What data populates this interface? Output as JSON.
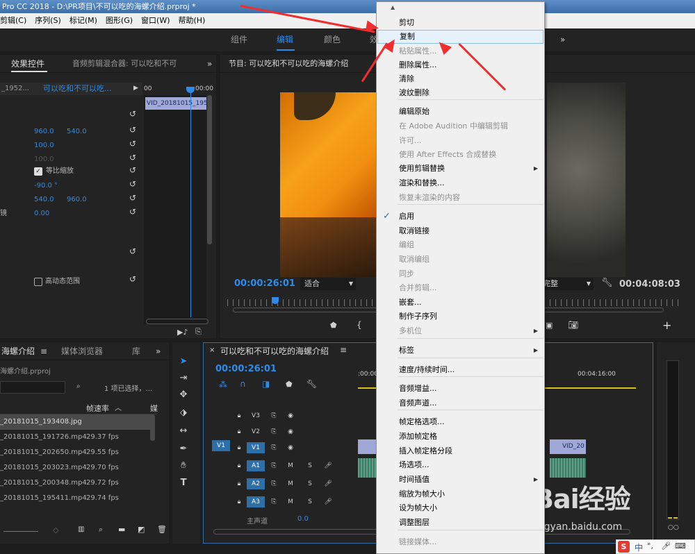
{
  "titlebar": {
    "text": "Pro CC 2018 - D:\\PR项目\\不可以吃的海螺介绍.prproj *"
  },
  "menubar": [
    "剪辑(C)",
    "序列(S)",
    "标记(M)",
    "图形(G)",
    "窗口(W)",
    "帮助(H)"
  ],
  "workspaces": [
    "组件",
    "编辑",
    "颜色",
    "效"
  ],
  "effect_controls": {
    "tab_label": "效果控件",
    "tab_mixer": "音频剪辑混合器: 可以吃和不可",
    "source_clip": "_1952...",
    "sequence": "可以吃和不可以吃...",
    "ruler_start": "00",
    "ruler_end": "00:00",
    "clip_label": "VID_20181015_195",
    "rows": {
      "pos_x": "960.0",
      "pos_y": "540.0",
      "scale": "100.0",
      "scale_w": "100.0",
      "uniform": "等比缩放",
      "rotation": "-90.0 °",
      "anchor_x": "540.0",
      "anchor_y": "960.0",
      "flicker_label": "镜",
      "flicker": "0.00",
      "hdr": "高动态范围"
    }
  },
  "program_monitor": {
    "title": "节目: 可以吃和不可以吃的海螺介绍",
    "timecode": "00:00:26:01",
    "fit": "适合",
    "quality": "完整",
    "duration": "00:04:08:03"
  },
  "project": {
    "tab": "海螺介绍",
    "tab2": "媒体浏览器",
    "tab3": "库",
    "file": "海螺介绍.prproj",
    "selected": "1 项已选择，...",
    "col_framerate": "帧速率",
    "col_more": "媒",
    "items": [
      {
        "name": "_20181015_193408.jpg",
        "fps": ""
      },
      {
        "name": "_20181015_191726.mp4",
        "fps": "29.37 fps"
      },
      {
        "name": "_20181015_202650.mp4",
        "fps": "29.55 fps"
      },
      {
        "name": "_20181015_203023.mp4",
        "fps": "29.70 fps"
      },
      {
        "name": "_20181015_200348.mp4",
        "fps": "29.72 fps"
      },
      {
        "name": "_20181015_195411.mp4",
        "fps": "29.74 fps"
      }
    ]
  },
  "timeline": {
    "title": "可以吃和不可以吃的海螺介绍",
    "timecode": "00:00:26:01",
    "ruler_left": ":00:00",
    "ruler_mid": "00:04:16:00",
    "ruler_right": "0",
    "tracks": [
      "V3",
      "V2",
      "V1",
      "A1",
      "A2",
      "A3"
    ],
    "src": "V1",
    "master": "主声道",
    "master_val": "0.0",
    "clip_v": "VID_20",
    "clip_a": "fx"
  },
  "context_menu": {
    "items": [
      {
        "label": "剪切",
        "state": "normal"
      },
      {
        "label": "复制",
        "state": "highlight"
      },
      {
        "label": "粘贴属性...",
        "state": "disabled"
      },
      {
        "label": "删除属性...",
        "state": "normal"
      },
      {
        "label": "清除",
        "state": "normal"
      },
      {
        "label": "波纹删除",
        "state": "normal"
      },
      {
        "label": "编辑原始",
        "state": "normal"
      },
      {
        "label": "在 Adobe Audition 中编辑剪辑",
        "state": "disabled"
      },
      {
        "label": "许可...",
        "state": "disabled"
      },
      {
        "label": "使用 After Effects 合成替换",
        "state": "disabled"
      },
      {
        "label": "使用剪辑替换",
        "state": "normal"
      },
      {
        "label": "渲染和替换...",
        "state": "normal"
      },
      {
        "label": "恢复未渲染的内容",
        "state": "disabled"
      },
      {
        "label": "启用",
        "state": "checked"
      },
      {
        "label": "取消链接",
        "state": "normal"
      },
      {
        "label": "编组",
        "state": "disabled"
      },
      {
        "label": "取消编组",
        "state": "disabled"
      },
      {
        "label": "同步",
        "state": "disabled"
      },
      {
        "label": "合并剪辑...",
        "state": "disabled"
      },
      {
        "label": "嵌套...",
        "state": "normal"
      },
      {
        "label": "制作子序列",
        "state": "normal"
      },
      {
        "label": "多机位",
        "state": "disabled"
      },
      {
        "label": "标签",
        "state": "normal"
      },
      {
        "label": "速度/持续时间...",
        "state": "normal"
      },
      {
        "label": "音频增益...",
        "state": "normal"
      },
      {
        "label": "音频声道...",
        "state": "normal"
      },
      {
        "label": "帧定格选项...",
        "state": "normal"
      },
      {
        "label": "添加帧定格",
        "state": "normal"
      },
      {
        "label": "插入帧定格分段",
        "state": "normal"
      },
      {
        "label": "场选项...",
        "state": "normal"
      },
      {
        "label": "时间插值",
        "state": "normal"
      },
      {
        "label": "缩放为帧大小",
        "state": "normal"
      },
      {
        "label": "设为帧大小",
        "state": "normal"
      },
      {
        "label": "调整图层",
        "state": "normal"
      },
      {
        "label": "链接媒体...",
        "state": "disabled"
      }
    ]
  },
  "watermark": {
    "text": "Bai经验",
    "url": "jingyan.baidu.com"
  },
  "ime": {
    "text": "中"
  },
  "colors": {
    "accent": "#2d8ceb",
    "arrow": "#f12d2d",
    "menu_bg": "#f0f0f0",
    "highlight": "#e5f1fb"
  }
}
